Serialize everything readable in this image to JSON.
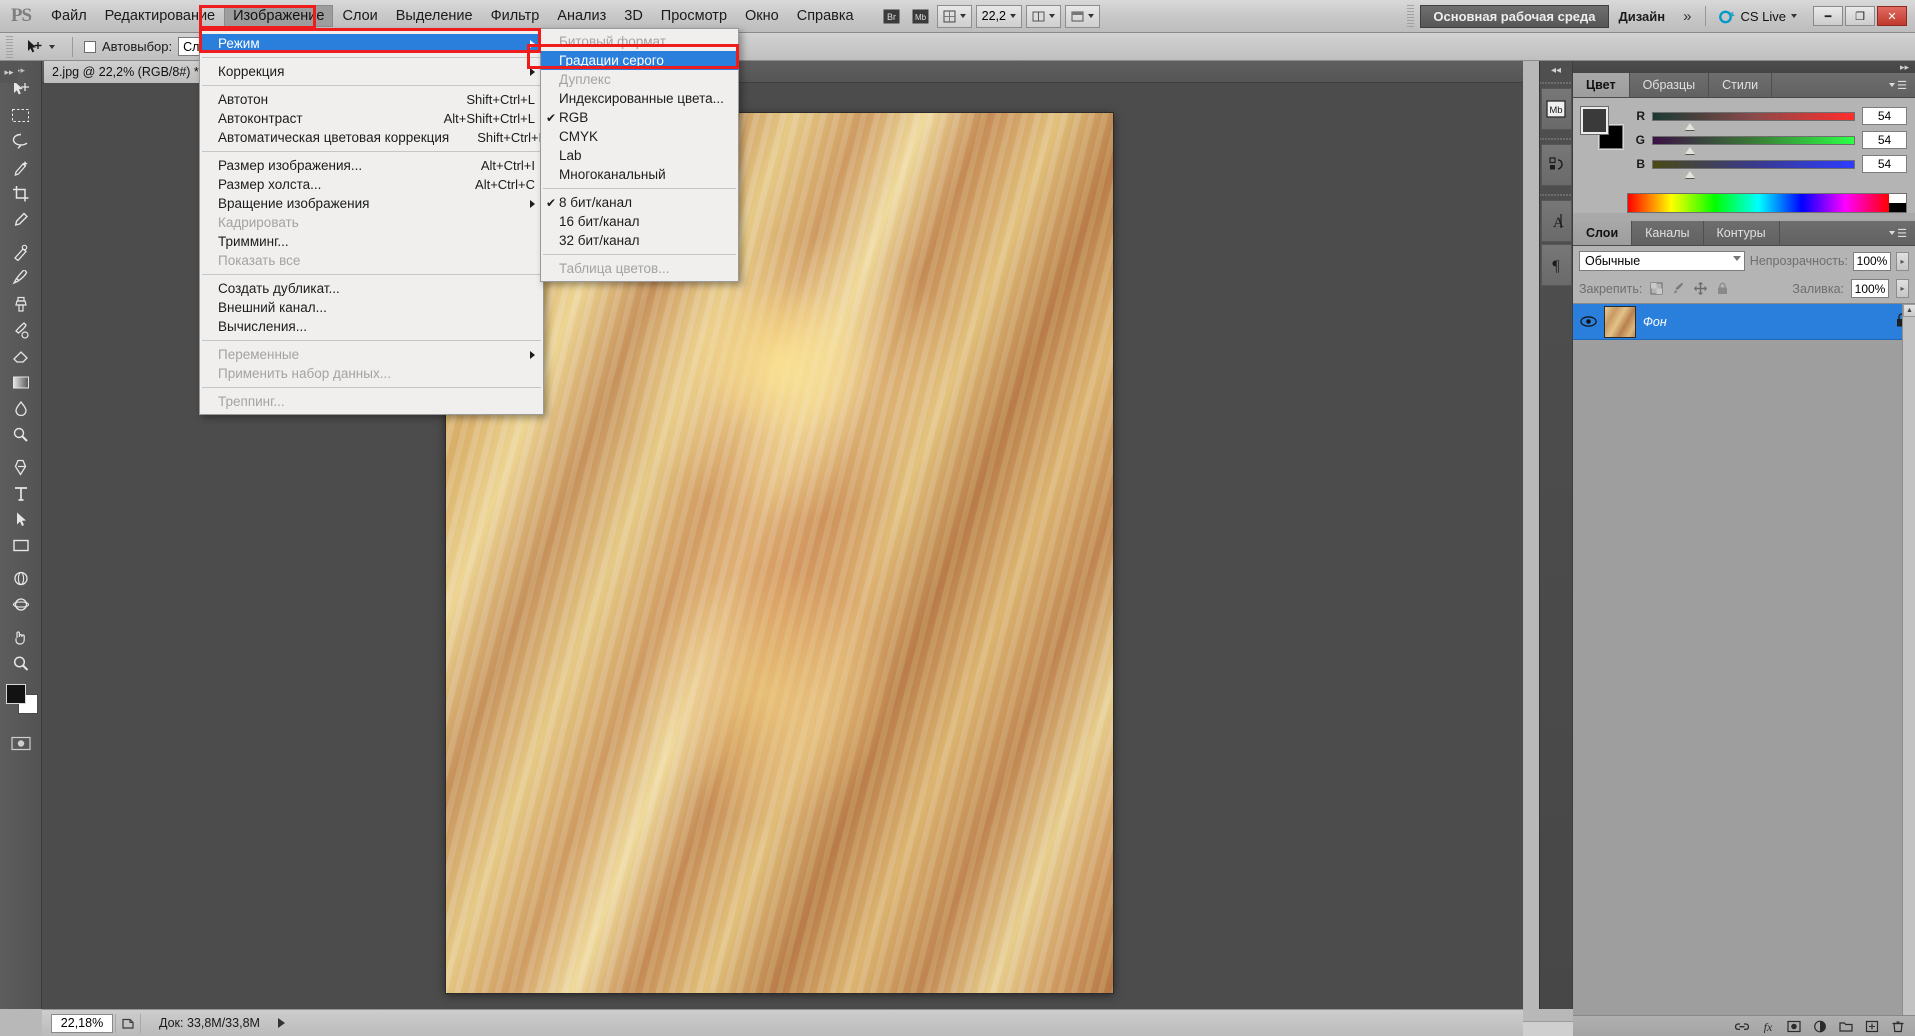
{
  "app": {
    "logo": "PS",
    "menus": [
      "Файл",
      "Редактирование",
      "Изображение",
      "Слои",
      "Выделение",
      "Фильтр",
      "Анализ",
      "3D",
      "Просмотр",
      "Окно",
      "Справка"
    ],
    "active_menu": "Изображение",
    "zoom_field": "22,2",
    "workspace_primary": "Основная рабочая среда",
    "workspace_secondary": "Дизайн",
    "workspace_more": "»",
    "cs_live": "CS Live",
    "window_buttons": [
      "minimize",
      "restore",
      "close"
    ],
    "accent_blue": "#2a7fdc",
    "highlight_red": "#ee1c1c"
  },
  "options_bar": {
    "tool_icon": "move-tool-icon",
    "autoselect_label": "Автовыбор:",
    "autoselect_checked": false,
    "autoselect_value": "Слой"
  },
  "document": {
    "tab_title": "2.jpg @ 22,2% (RGB/8#) *",
    "close_glyph": "×"
  },
  "status_bar": {
    "zoom": "22,18%",
    "doc_info": "Док: 33,8M/33,8M"
  },
  "image_menu": {
    "items": [
      {
        "label": "Режим",
        "shortcut": "",
        "submenu": true,
        "selected": true,
        "disabled": false
      },
      {
        "type": "separator"
      },
      {
        "label": "Коррекция",
        "shortcut": "",
        "submenu": true,
        "selected": false,
        "disabled": false
      },
      {
        "type": "separator"
      },
      {
        "label": "Автотон",
        "shortcut": "Shift+Ctrl+L",
        "submenu": false,
        "selected": false,
        "disabled": false
      },
      {
        "label": "Автоконтраст",
        "shortcut": "Alt+Shift+Ctrl+L",
        "submenu": false,
        "selected": false,
        "disabled": false
      },
      {
        "label": "Автоматическая цветовая коррекция",
        "shortcut": "Shift+Ctrl+B",
        "submenu": false,
        "selected": false,
        "disabled": false
      },
      {
        "type": "separator"
      },
      {
        "label": "Размер изображения...",
        "shortcut": "Alt+Ctrl+I",
        "submenu": false,
        "selected": false,
        "disabled": false
      },
      {
        "label": "Размер холста...",
        "shortcut": "Alt+Ctrl+C",
        "submenu": false,
        "selected": false,
        "disabled": false
      },
      {
        "label": "Вращение изображения",
        "shortcut": "",
        "submenu": true,
        "selected": false,
        "disabled": false
      },
      {
        "label": "Кадрировать",
        "shortcut": "",
        "submenu": false,
        "selected": false,
        "disabled": true
      },
      {
        "label": "Тримминг...",
        "shortcut": "",
        "submenu": false,
        "selected": false,
        "disabled": false
      },
      {
        "label": "Показать все",
        "shortcut": "",
        "submenu": false,
        "selected": false,
        "disabled": true
      },
      {
        "type": "separator"
      },
      {
        "label": "Создать дубликат...",
        "shortcut": "",
        "submenu": false,
        "selected": false,
        "disabled": false
      },
      {
        "label": "Внешний канал...",
        "shortcut": "",
        "submenu": false,
        "selected": false,
        "disabled": false
      },
      {
        "label": "Вычисления...",
        "shortcut": "",
        "submenu": false,
        "selected": false,
        "disabled": false
      },
      {
        "type": "separator"
      },
      {
        "label": "Переменные",
        "shortcut": "",
        "submenu": true,
        "selected": false,
        "disabled": true
      },
      {
        "label": "Применить набор данных...",
        "shortcut": "",
        "submenu": false,
        "selected": false,
        "disabled": true
      },
      {
        "type": "separator"
      },
      {
        "label": "Треппинг...",
        "shortcut": "",
        "submenu": false,
        "selected": false,
        "disabled": true
      }
    ]
  },
  "mode_submenu": {
    "items": [
      {
        "label": "Битовый формат",
        "checked": false,
        "selected": false,
        "disabled": true
      },
      {
        "label": "Градации серого",
        "checked": false,
        "selected": true,
        "disabled": false
      },
      {
        "label": "Дуплекс",
        "checked": false,
        "selected": false,
        "disabled": true
      },
      {
        "label": "Индексированные цвета...",
        "checked": false,
        "selected": false,
        "disabled": false
      },
      {
        "label": "RGB",
        "checked": true,
        "selected": false,
        "disabled": false
      },
      {
        "label": "CMYK",
        "checked": false,
        "selected": false,
        "disabled": false
      },
      {
        "label": "Lab",
        "checked": false,
        "selected": false,
        "disabled": false
      },
      {
        "label": "Многоканальный",
        "checked": false,
        "selected": false,
        "disabled": false
      },
      {
        "type": "separator"
      },
      {
        "label": "8 бит/канал",
        "checked": true,
        "selected": false,
        "disabled": false
      },
      {
        "label": "16 бит/канал",
        "checked": false,
        "selected": false,
        "disabled": false
      },
      {
        "label": "32 бит/канал",
        "checked": false,
        "selected": false,
        "disabled": false
      },
      {
        "type": "separator"
      },
      {
        "label": "Таблица цветов...",
        "checked": false,
        "selected": false,
        "disabled": true
      }
    ]
  },
  "color_panel": {
    "tabs": [
      "Цвет",
      "Образцы",
      "Стили"
    ],
    "active_tab": "Цвет",
    "foreground_hex": "#3a3a3a",
    "background_hex": "#000000",
    "channels": [
      {
        "name": "R",
        "value": "54"
      },
      {
        "name": "G",
        "value": "54"
      },
      {
        "name": "B",
        "value": "54"
      }
    ]
  },
  "layers_panel": {
    "tabs": [
      "Слои",
      "Каналы",
      "Контуры"
    ],
    "active_tab": "Слои",
    "blend_mode": "Обычные",
    "opacity_label": "Непрозрачность:",
    "opacity_value": "100%",
    "lock_label": "Закрепить:",
    "fill_label": "Заливка:",
    "fill_value": "100%",
    "lock_icons": [
      "lock-transparency-icon",
      "lock-pixels-icon",
      "lock-position-icon",
      "lock-all-icon"
    ],
    "layers": [
      {
        "name": "Фон",
        "visible": true,
        "locked": true,
        "selected": true
      }
    ],
    "footer_icons": [
      "link-layers-icon",
      "layer-style-icon",
      "layer-mask-icon",
      "new-group-icon",
      "adjustment-layer-icon",
      "new-layer-icon",
      "delete-layer-icon"
    ]
  },
  "icon_rail": {
    "buttons": [
      "mini-bridge-icon",
      "history-icon",
      "character-icon",
      "paragraph-icon"
    ]
  },
  "toolbar": {
    "tools": [
      "move-tool-icon",
      "marquee-tool-icon",
      "lasso-tool-icon",
      "quick-select-tool-icon",
      "crop-tool-icon",
      "eyedropper-tool-icon",
      "healing-brush-icon",
      "brush-tool-icon",
      "clone-stamp-icon",
      "history-brush-icon",
      "eraser-tool-icon",
      "gradient-tool-icon",
      "blur-tool-icon",
      "dodge-tool-icon",
      "pen-tool-icon",
      "type-tool-icon",
      "path-select-icon",
      "shape-tool-icon",
      "3d-rotate-icon",
      "3d-orbit-icon",
      "hand-tool-icon",
      "zoom-tool-icon"
    ]
  }
}
